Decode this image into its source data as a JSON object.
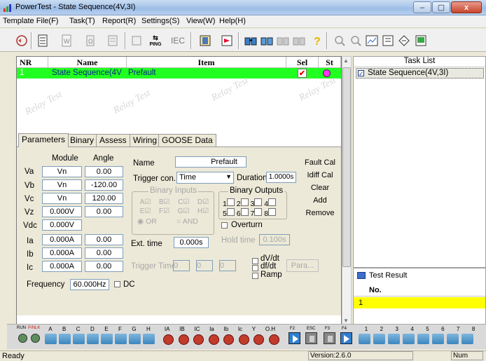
{
  "window": {
    "title": "PowerTest - State Sequence(4V,3I)",
    "min": "–",
    "max": "▢",
    "close": "x"
  },
  "menu": [
    "Template File(F)",
    "Task(T)",
    "Report(R)",
    "Settings(S)",
    "View(W)",
    "Help(H)"
  ],
  "toolbar": {
    "ping": "PING",
    "iec": "IEC"
  },
  "grid": {
    "headers": {
      "nr": "NR",
      "name": "Name",
      "item": "Item",
      "sel": "Sel",
      "st": "St"
    },
    "row": {
      "nr": "1",
      "name": "State Sequence(4V",
      "item": "Prefault",
      "sel": "✔"
    },
    "watermark": "Relay Test"
  },
  "tabs": [
    "Parameters",
    "Binary",
    "Assess",
    "Wiring",
    "GOOSE Data"
  ],
  "params": {
    "module_hd": "Module",
    "angle_hd": "Angle",
    "rows": [
      {
        "label": "Va",
        "module": "Vn",
        "angle": "0.00"
      },
      {
        "label": "Vb",
        "module": "Vn",
        "angle": "-120.00"
      },
      {
        "label": "Vc",
        "module": "Vn",
        "angle": "120.00"
      },
      {
        "label": "Vz",
        "module": "0.000V",
        "angle": "0.00"
      },
      {
        "label": "Vdc",
        "module": "0.000V",
        "angle": ""
      },
      {
        "label": "Ia",
        "module": "0.000A",
        "angle": "0.00"
      },
      {
        "label": "Ib",
        "module": "0.000A",
        "angle": "0.00"
      },
      {
        "label": "Ic",
        "module": "0.000A",
        "angle": "0.00"
      }
    ],
    "frequency_label": "Frequency",
    "frequency": "60.000Hz",
    "dc_label": "DC",
    "name_label": "Name",
    "name_value": "Prefault",
    "trigger_label": "Trigger con.",
    "trigger_value": "Time",
    "duration_label": "Duration",
    "duration_value": "1.0000s",
    "binary_inputs": "Binary Inputs",
    "binary_outputs": "Binary Outputs",
    "bi_letters": [
      "A",
      "B",
      "C",
      "D",
      "E",
      "F",
      "G",
      "H"
    ],
    "bo_numbers": [
      "1",
      "2",
      "3",
      "4",
      "5",
      "6",
      "7",
      "8"
    ],
    "or": "OR",
    "and": "AND",
    "overturn": "Overturn",
    "hold_label": "Hold time",
    "hold_value": "0.100s",
    "ext_label": "Ext. time",
    "ext_value": "0.000s",
    "trig_time_label": "Trigger Time",
    "trig_time": [
      "0",
      "0",
      "0"
    ],
    "dvdt": "dV/dt",
    "dfdt": "df/dt",
    "ramp": "Ramp",
    "para": "Para...",
    "buttons": [
      "Fault Cal",
      "Idiff Cal",
      "Clear",
      "Add",
      "Remove"
    ]
  },
  "tasklist": {
    "title": "Task List",
    "item": "State Sequence(4V,3I)"
  },
  "testresult": {
    "title": "Test Result",
    "col": "No.",
    "row": "1"
  },
  "indicators": {
    "run": "RUN",
    "pinlk": "P/NLK",
    "bin_letters": [
      "A",
      "B",
      "C",
      "D",
      "E",
      "F",
      "G",
      "H"
    ],
    "analog": [
      "IA",
      "IB",
      "IC",
      "Ia",
      "Ib",
      "Ic",
      "Y",
      "O.H"
    ],
    "fkeys": [
      "F2",
      "ESC",
      "F3",
      "F4"
    ],
    "bo": [
      "1",
      "2",
      "3",
      "4",
      "5",
      "6",
      "7",
      "8"
    ]
  },
  "status": {
    "left": "Ready",
    "version": "Version:2.6.0",
    "num": "Num"
  },
  "colors": {
    "row_green": "#21ff21",
    "magenta": "#ff33ff",
    "result_yellow": "#ffff00"
  }
}
